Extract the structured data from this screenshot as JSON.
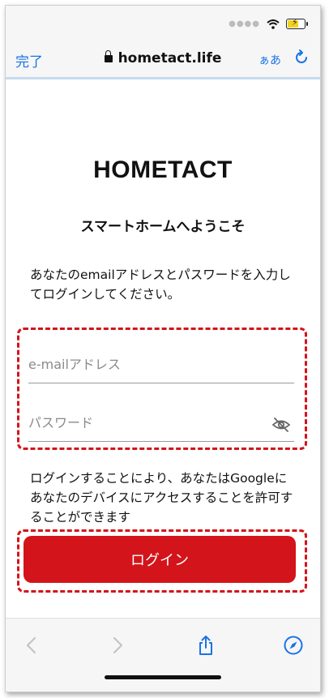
{
  "browser": {
    "done_label": "完了",
    "url": "hometact.life",
    "text_size_label": "ぁあ"
  },
  "icons": {
    "signal": "signal-dots-icon",
    "wifi": "wifi-icon",
    "battery": "battery-charging-icon",
    "lock": "lock-icon",
    "reload": "reload-icon",
    "eye": "eye-slash-icon",
    "back": "chevron-left-icon",
    "forward": "chevron-right-icon",
    "share": "share-icon",
    "compass": "compass-icon"
  },
  "page": {
    "logo": "HOMETACT",
    "welcome": "スマートホームへようこそ",
    "description": "あなたのemailアドレスとパスワードを入力してログインしてください。",
    "email_placeholder": "e-mailアドレス",
    "password_placeholder": "パスワード",
    "notice": "ログインすることにより、あなたはGoogleにあなたのデバイスにアクセスすることを許可することができます",
    "login_label": "ログイン"
  },
  "colors": {
    "accent": "#d3141b",
    "link": "#1a73e8"
  }
}
